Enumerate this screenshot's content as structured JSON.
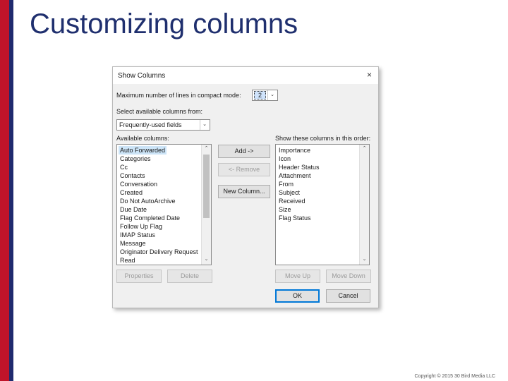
{
  "slide": {
    "title": "Customizing columns",
    "copyright": "Copyright © 2015 30 Bird Media LLC",
    "accent_red": "#c0142a",
    "accent_blue": "#1f2a6e"
  },
  "dialog": {
    "title": "Show Columns",
    "close_icon": "×",
    "compact_mode_label": "Maximum number of lines in compact mode:",
    "compact_mode_value": "2",
    "select_from_label": "Select available columns from:",
    "select_from_value": "Frequently-used fields",
    "available_label": "Available columns:",
    "shown_label": "Show these columns in this order:",
    "available_columns": [
      "Auto Forwarded",
      "Categories",
      "Cc",
      "Contacts",
      "Conversation",
      "Created",
      "Do Not AutoArchive",
      "Due Date",
      "Flag Completed Date",
      "Follow Up Flag",
      "IMAP Status",
      "Message",
      "Originator Delivery Request",
      "Read"
    ],
    "shown_columns": [
      "Importance",
      "Icon",
      "Header Status",
      "Attachment",
      "From",
      "Subject",
      "Received",
      "Size",
      "Flag Status"
    ],
    "buttons": {
      "add": "Add ->",
      "remove": "<- Remove",
      "new_column": "New Column...",
      "properties": "Properties",
      "delete": "Delete",
      "move_up": "Move Up",
      "move_down": "Move Down",
      "ok": "OK",
      "cancel": "Cancel"
    },
    "arrow_down_icon": "⌄",
    "arrow_up_icon": "⌃"
  }
}
